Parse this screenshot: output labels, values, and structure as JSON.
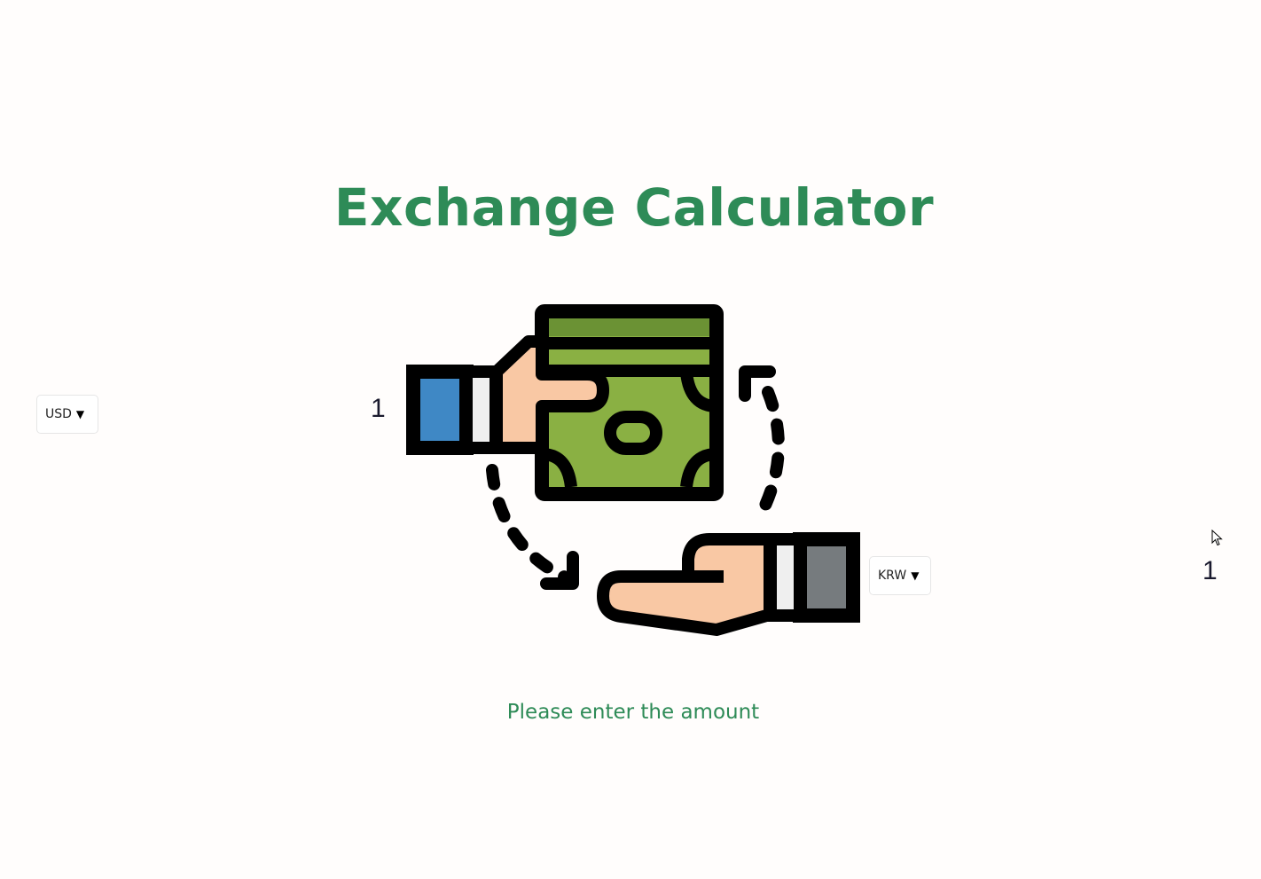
{
  "page": {
    "title": "Exchange Calculator",
    "message": "Please enter the amount"
  },
  "from": {
    "currency": "USD",
    "amount": "1"
  },
  "to": {
    "currency": "KRW",
    "amount": "1"
  },
  "icons": {
    "caret": "caret-down-icon",
    "illustration": "money-exchange-illustration",
    "cursor": "mouse-pointer-icon"
  },
  "colors": {
    "accent": "#2e8b57",
    "background": "#fffdfc",
    "bill_light": "#8ab043",
    "bill_dark": "#6b9234",
    "skin": "#f9c8a4",
    "sleeve_blue": "#3f88c5",
    "sleeve_gray": "#767b7e"
  }
}
